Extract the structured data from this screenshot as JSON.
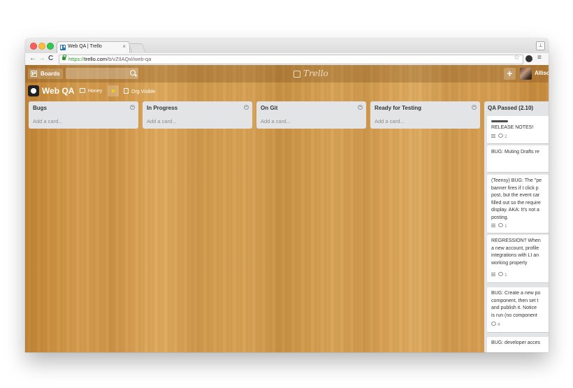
{
  "browser": {
    "tab_title": "Web QA | Trello",
    "tab_close": "×",
    "url_scheme": "https://",
    "url_host": "trello.com",
    "url_path": "/b/vZIlAQxl/web-qa",
    "profile_icon": "person-icon"
  },
  "header": {
    "boards_label": "Boards",
    "logo_text": "Trello",
    "add_label": "+",
    "user_name": "Allison"
  },
  "board": {
    "title": "Web QA",
    "org_name": "Honey",
    "star": "★",
    "visibility": "Org Visible"
  },
  "lists": [
    {
      "title": "Bugs",
      "add_card": "Add a card..."
    },
    {
      "title": "In Progress",
      "add_card": "Add a card..."
    },
    {
      "title": "On Git",
      "add_card": "Add a card..."
    },
    {
      "title": "Ready for Testing",
      "add_card": "Add a card..."
    }
  ],
  "qa_list": {
    "title": "QA Passed (2.10)",
    "cards": [
      {
        "text": "RELEASE NOTES!",
        "comments": "2"
      },
      {
        "text": "BUG: Muting Drafts re"
      },
      {
        "text": "(Teensy) BUG: The \"pe\nbanner fires if I click p\npost, but the event car\nfilled out so the require\ndisplay. AKA: It's not a\nposting.",
        "comments": "1"
      },
      {
        "text": "REGRESSION? When\na new account, profile\nintegrations with LI an\nworking properly",
        "comments": "1"
      },
      {
        "text": "BUG: Create a new po\ncomponent, then set t\nand publish it. Notice \nis run (no component",
        "comments": "4"
      },
      {
        "text": "BUG: developer acces"
      }
    ]
  }
}
